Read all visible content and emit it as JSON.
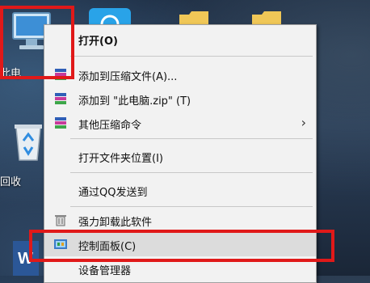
{
  "desktop": {
    "this_pc_label": "此电",
    "recycle_bin_label": "回收"
  },
  "context_menu": {
    "items": [
      {
        "label": "打开(O)",
        "icon": "none"
      },
      {
        "label": "添加到压缩文件(A)...",
        "icon": "winrar-icon"
      },
      {
        "label": "添加到 \"此电脑.zip\" (T)",
        "icon": "winrar-icon"
      },
      {
        "label": "其他压缩命令",
        "icon": "winrar-icon"
      },
      {
        "label": "打开文件夹位置(I)",
        "icon": "none"
      },
      {
        "label": "通过QQ发送到",
        "icon": "none"
      },
      {
        "label": "强力卸载此软件",
        "icon": "trash-icon"
      },
      {
        "label": "控制面板(C)",
        "icon": "control-panel-icon"
      },
      {
        "label": "设备管理器",
        "icon": "none"
      }
    ],
    "submenu_arrow": "›"
  },
  "highlight_color": "#e01919"
}
